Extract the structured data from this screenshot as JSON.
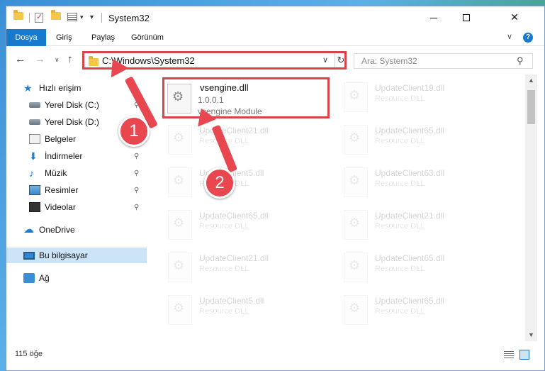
{
  "window": {
    "title": "System32",
    "controls": {
      "minimize": "minimize",
      "maximize": "maximize",
      "close": "✕"
    }
  },
  "quick_access_toolbar": {
    "dropdown": "▾",
    "customize": "▾"
  },
  "ribbon": {
    "tabs": [
      {
        "label": "Dosya",
        "active": true
      },
      {
        "label": "Giriş"
      },
      {
        "label": "Paylaş"
      },
      {
        "label": "Görünüm"
      }
    ],
    "collapse_glyph": "∨",
    "help_glyph": "?"
  },
  "navigation": {
    "back": "←",
    "forward": "→",
    "recent": "∨",
    "up": "↑",
    "address": "C:\\Windows\\System32",
    "address_dropdown": "∨",
    "refresh": "↻",
    "search_placeholder": "Ara: System32",
    "search_glyph": "⚲"
  },
  "sidebar": {
    "items": [
      {
        "label": "Hızlı erişim",
        "icon": "star-icon",
        "level": 0
      },
      {
        "label": "Yerel Disk (C:)",
        "icon": "drive-icon",
        "pinned": true,
        "level": 1
      },
      {
        "label": "Yerel Disk (D:)",
        "icon": "drive-icon",
        "level": 1
      },
      {
        "label": "Belgeler",
        "icon": "documents-icon",
        "level": 1
      },
      {
        "label": "İndirmeler",
        "icon": "download-icon",
        "pinned": true,
        "level": 1
      },
      {
        "label": "Müzik",
        "icon": "music-icon",
        "pinned": true,
        "level": 1
      },
      {
        "label": "Resimler",
        "icon": "pictures-icon",
        "pinned": true,
        "level": 1
      },
      {
        "label": "Videolar",
        "icon": "videos-icon",
        "pinned": true,
        "level": 1
      },
      {
        "label": "OneDrive",
        "icon": "cloud-icon",
        "level": 0
      },
      {
        "label": "Bu bilgisayar",
        "icon": "computer-icon",
        "selected": true,
        "level": 0
      },
      {
        "label": "Ağ",
        "icon": "network-icon",
        "level": 0
      }
    ],
    "pin_glyph": "📌"
  },
  "files": {
    "featured": {
      "name": "vsengine.dll",
      "version": "1.0.0.1",
      "description": "vsengine Module"
    },
    "left_column": [
      {
        "name": "UpdateClient21.dll",
        "type": "Resource DLL"
      },
      {
        "name": "UpdateClient5.dll",
        "type": "Resource DLL"
      },
      {
        "name": "UpdateClient65.dll",
        "type": "Resource DLL"
      },
      {
        "name": "UpdateClient21.dll",
        "type": "Resource DLL"
      },
      {
        "name": "UpdateClient5.dll",
        "type": "Resource DLL"
      }
    ],
    "right_column": [
      {
        "name": "UpdateClient19.dll",
        "type": "Resource DLL"
      },
      {
        "name": "UpdateClient65.dll",
        "type": "Resource DLL"
      },
      {
        "name": "UpdateClient63.dll",
        "type": "Resource DLL"
      },
      {
        "name": "UpdateClient21.dll",
        "type": "Resource DLL"
      },
      {
        "name": "UpdateClient65.dll",
        "type": "Resource DLL"
      },
      {
        "name": "UpdateClient65.dll",
        "type": "Resource DLL"
      }
    ]
  },
  "scrollbar": {
    "up": "▲",
    "down": "▼"
  },
  "status": {
    "item_count": "115 öğe"
  },
  "callouts": [
    {
      "number": "1"
    },
    {
      "number": "2"
    }
  ],
  "colors": {
    "accent": "#1979ca",
    "highlight_box": "#d9434c",
    "callout": "#e8474f",
    "selection": "#cce4f7"
  }
}
